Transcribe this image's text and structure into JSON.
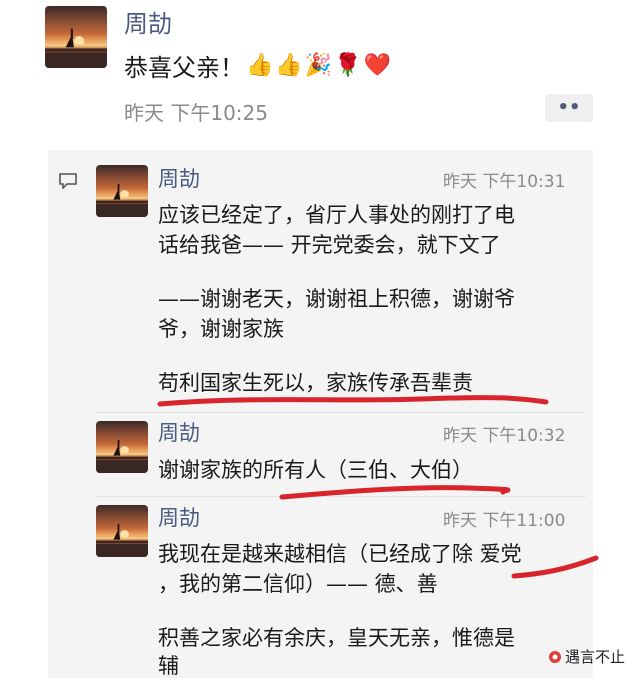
{
  "post": {
    "author": "周劼",
    "content": "恭喜父亲！",
    "emoji": [
      "👍",
      "👍",
      "🎉",
      "🌹",
      "❤️"
    ],
    "emoji_icons": [
      "thumbs-up-icon",
      "thumbs-up-icon",
      "party-popper-icon",
      "rose-icon",
      "heart-icon"
    ],
    "time": "昨天 下午10:25",
    "more_label": "••"
  },
  "comments": [
    {
      "author": "周劼",
      "time": "昨天 下午10:31",
      "lines": [
        "应该已经定了，省厅人事处的刚打了电",
        "话给我爸—— 开完党委会，就下文了",
        "——谢谢老天，谢谢祖上积德，谢谢爷",
        "爷，谢谢家族",
        "苟利国家生死以，家族传承吾辈责"
      ]
    },
    {
      "author": "周劼",
      "time": "昨天 下午10:32",
      "lines": [
        "谢谢家族的所有人（三伯、大伯）"
      ]
    },
    {
      "author": "周劼",
      "time": "昨天 下午11:00",
      "lines": [
        "我现在是越来越相信（已经成了除 爱党",
        "，我的第二信仰）—— 德、善",
        "积善之家必有余庆，皇天无亲，惟德是",
        "辅"
      ]
    }
  ],
  "watermark": "遇言不止",
  "colors": {
    "name": "#4a5a82",
    "panel": "#f4f4f4",
    "underline": "#d8252b"
  }
}
